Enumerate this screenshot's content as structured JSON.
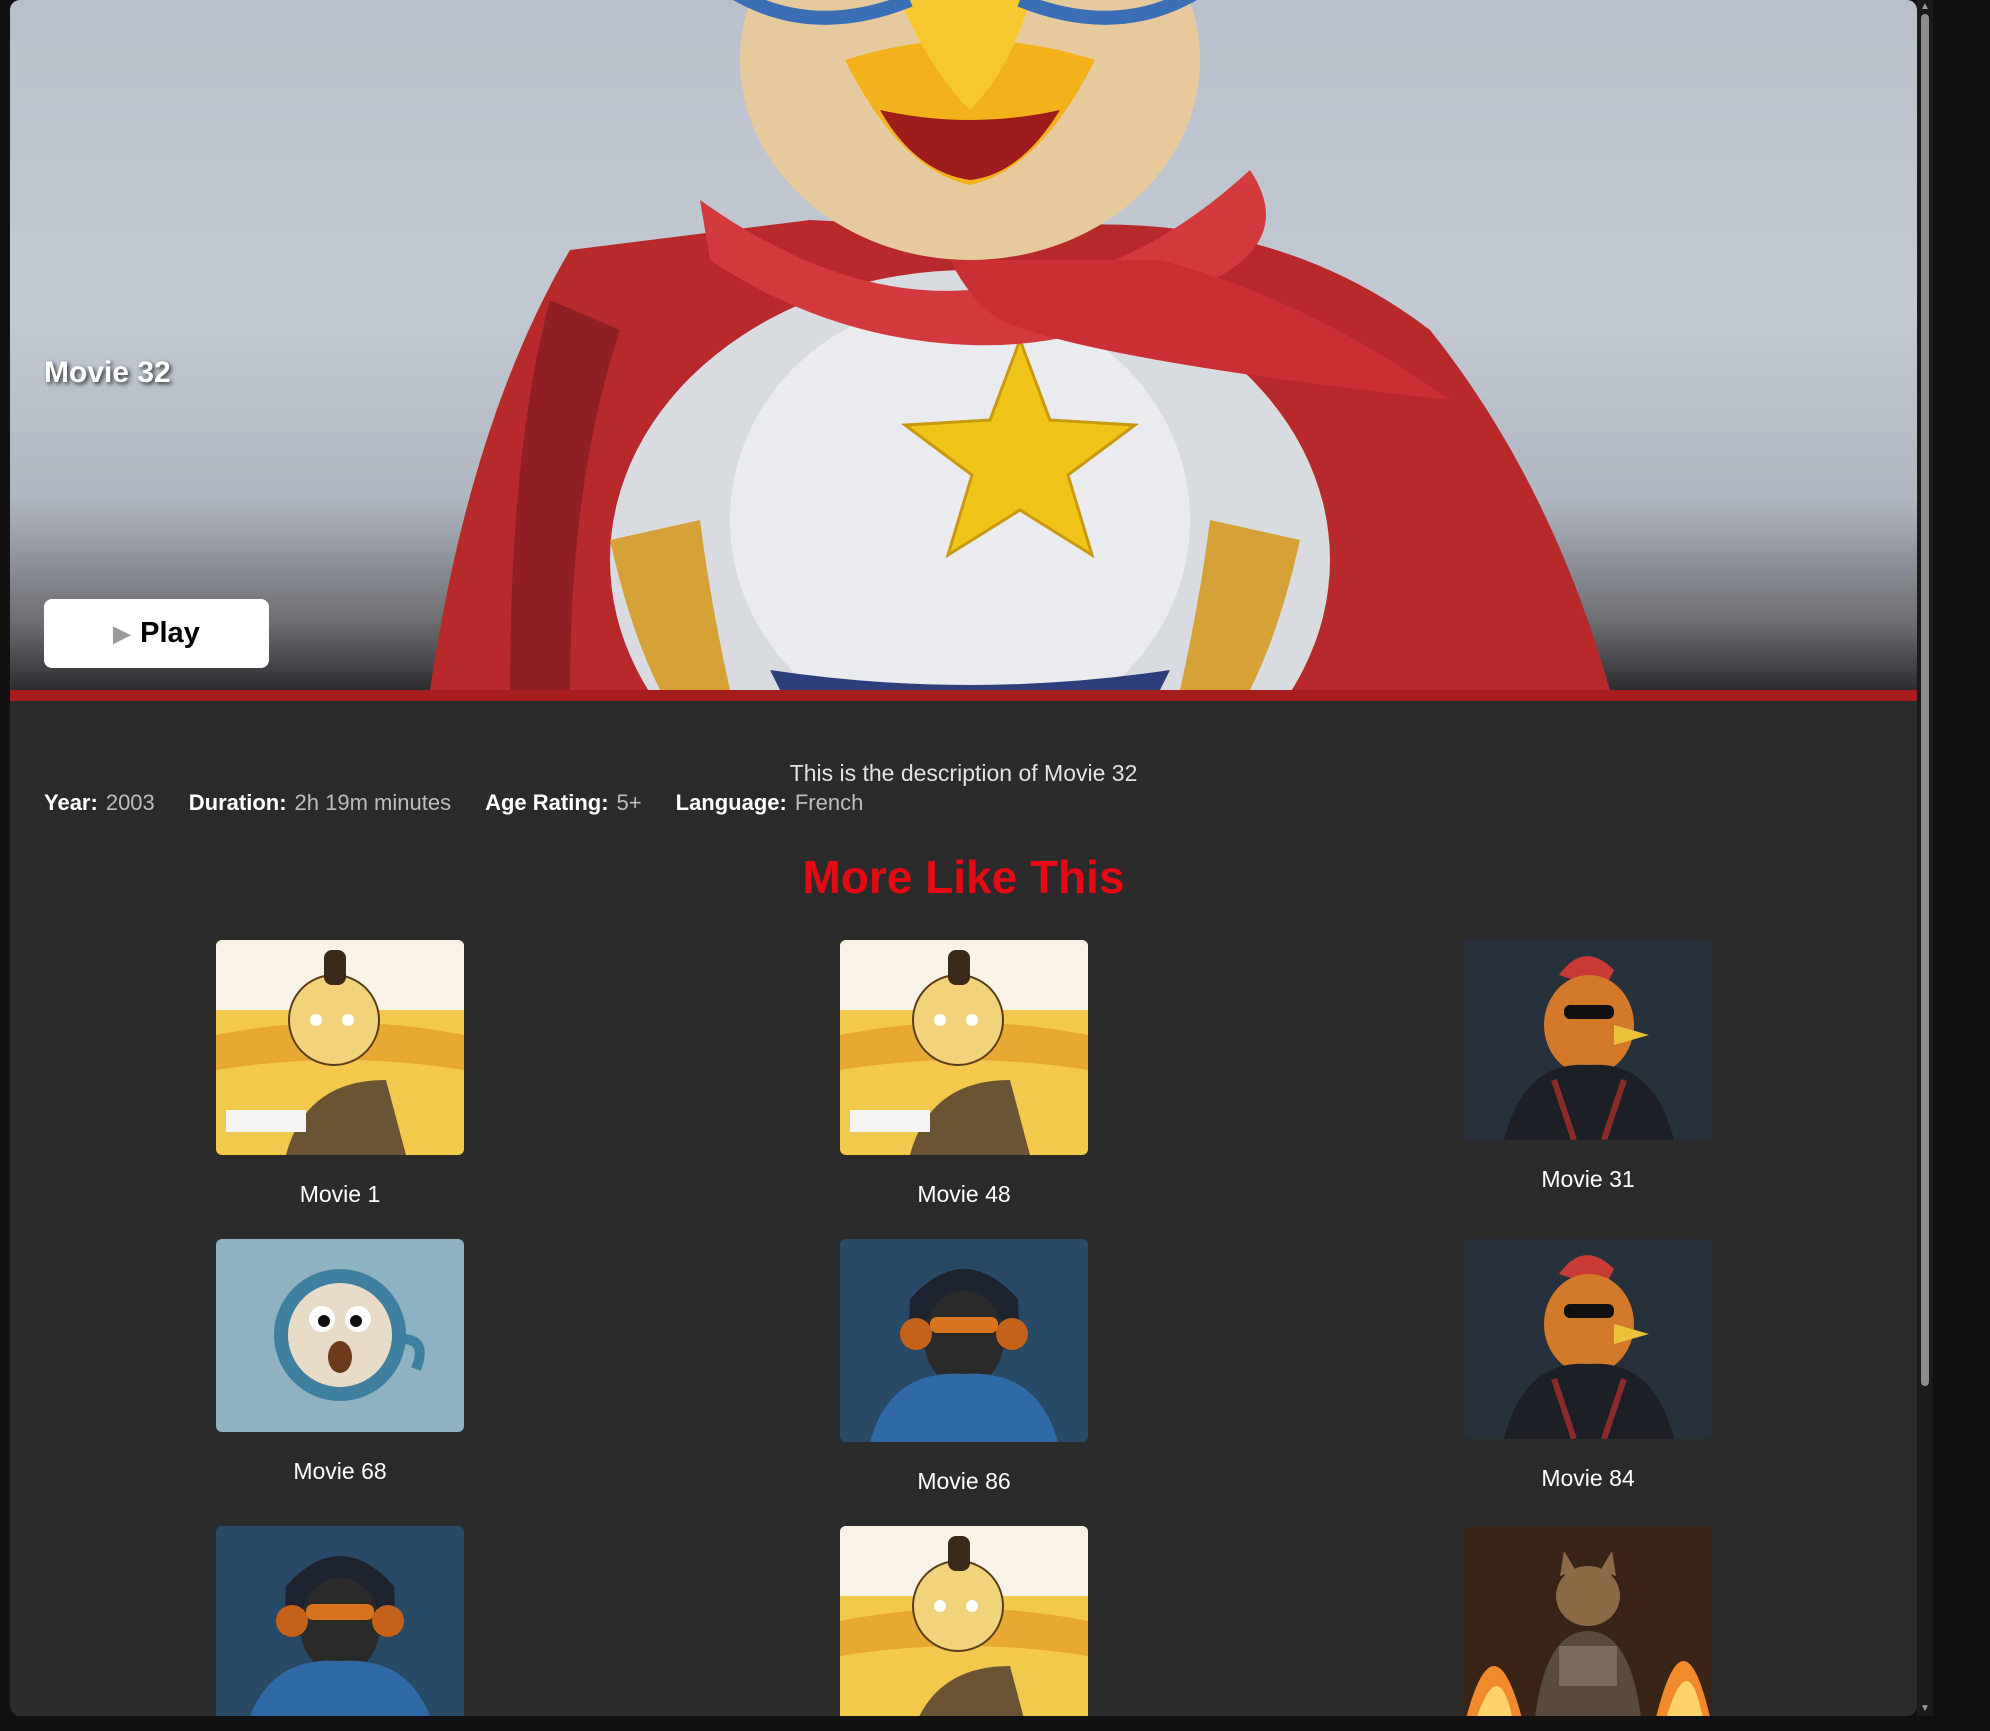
{
  "hero": {
    "title": "Movie 32",
    "play_label": "Play",
    "play_icon": "play-icon"
  },
  "details": {
    "description": "This is the description of Movie 32",
    "year_label": "Year:",
    "year": "2003",
    "duration_label": "Duration:",
    "duration": "2h 19m minutes",
    "age_label": "Age Rating:",
    "age": "5+",
    "language_label": "Language:",
    "language": "French"
  },
  "more_like_this": {
    "title": "More Like This",
    "items": [
      {
        "title": "Movie 1",
        "art": "cartoon-boy-desert"
      },
      {
        "title": "Movie 48",
        "art": "cartoon-boy-desert"
      },
      {
        "title": "Movie 31",
        "art": "rooster-leather-jacket"
      },
      {
        "title": "Movie 68",
        "art": "coffee-cup-face"
      },
      {
        "title": "Movie 86",
        "art": "monkey-headphones"
      },
      {
        "title": "Movie 84",
        "art": "rooster-leather-jacket"
      },
      {
        "title": "",
        "art": "monkey-headphones"
      },
      {
        "title": "",
        "art": "cartoon-boy-desert"
      },
      {
        "title": "",
        "art": "cat-armor-fire"
      }
    ]
  },
  "colors": {
    "accent": "#e50914",
    "background": "#2b2b2b",
    "hero_stripe": "#a51d1d"
  }
}
